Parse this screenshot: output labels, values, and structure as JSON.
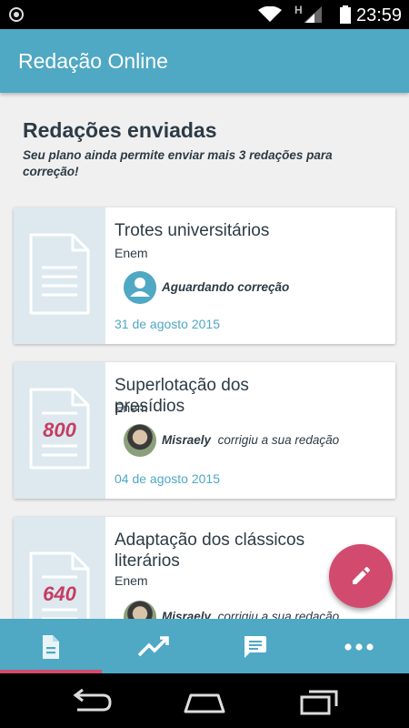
{
  "status_bar": {
    "time": "23:59",
    "network_label": "H"
  },
  "app_bar": {
    "title": "Redação Online"
  },
  "page": {
    "title": "Redações enviadas",
    "subtitle": "Seu plano ainda permite enviar mais 3 redações para correção!"
  },
  "essays": [
    {
      "title": "Trotes universitários",
      "exam": "Enem",
      "grade": "",
      "reviewer": "",
      "status": "Aguardando correção",
      "date": "31 de agosto 2015"
    },
    {
      "title": "Superlotação dos presídios",
      "exam": "Enem",
      "grade": "800",
      "reviewer": "Misraely",
      "status": "corrigiu a sua redação",
      "date": "04 de agosto 2015"
    },
    {
      "title": "Adaptação dos clássicos literários",
      "exam": "Enem",
      "grade": "640",
      "reviewer": "Misraely",
      "status": "corrigiu a sua redação",
      "date": ""
    }
  ],
  "bottom_nav": {
    "items": [
      {
        "icon": "document-icon",
        "active": true
      },
      {
        "icon": "trending-up-icon",
        "active": false
      },
      {
        "icon": "chat-icon",
        "active": false
      },
      {
        "icon": "more-icon",
        "active": false
      }
    ]
  },
  "colors": {
    "primary": "#4fa8c4",
    "accent": "#d24a6e",
    "text_dark": "#2d3b45",
    "thumb_bg": "#dde9ef"
  }
}
